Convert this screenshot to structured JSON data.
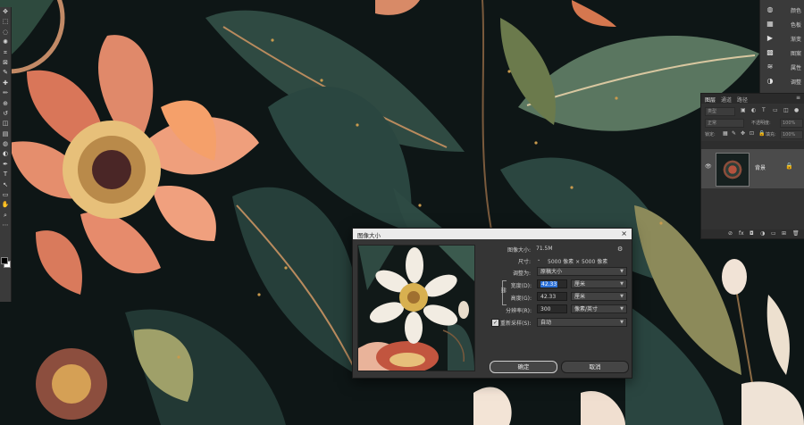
{
  "toolbar": {
    "icons": [
      "move-icon",
      "marquee-icon",
      "lasso-icon",
      "quick-select-icon",
      "crop-icon",
      "frame-icon",
      "eyedropper-icon",
      "healing-icon",
      "brush-icon",
      "stamp-icon",
      "history-brush-icon",
      "eraser-icon",
      "gradient-icon",
      "blur-icon",
      "dodge-icon",
      "pen-icon",
      "type-icon",
      "path-select-icon",
      "shape-icon",
      "hand-icon",
      "zoom-icon",
      "more-icon"
    ],
    "glyphs": [
      "✥",
      "⬚",
      "◌",
      "✺",
      "⌗",
      "⊠",
      "✎",
      "✚",
      "✏",
      "⊕",
      "↺",
      "◫",
      "▤",
      "◍",
      "◐",
      "✒",
      "T",
      "↖",
      "▭",
      "✋",
      "⌕",
      "⋯"
    ]
  },
  "dock": {
    "items": [
      {
        "icon": "brush-settings-icon",
        "glyph": "◍",
        "label": "颜色"
      },
      {
        "icon": "swatches-icon",
        "glyph": "▦",
        "label": "色板"
      },
      {
        "icon": "gradient-panel-icon",
        "glyph": "▶",
        "label": "渐变"
      },
      {
        "icon": "pattern-icon",
        "glyph": "▩",
        "label": "图案"
      },
      {
        "icon": "properties-icon",
        "glyph": "≋",
        "label": "属性"
      },
      {
        "icon": "adjust-icon",
        "glyph": "◑",
        "label": "调整"
      }
    ]
  },
  "layers": {
    "tabs": [
      "图层",
      "通道",
      "路径"
    ],
    "kind_placeholder": "类型",
    "mode": "正常",
    "opacity_label": "不透明度:",
    "opacity_value": "100%",
    "lock_label": "锁定:",
    "fill_label": "填充:",
    "fill_value": "100%",
    "layer_name": "背景",
    "footer_icons": [
      "link-icon",
      "fx-icon",
      "mask-icon",
      "adjustment-icon",
      "group-icon",
      "new-layer-icon",
      "trash-icon"
    ],
    "footer_glyphs": [
      "⊘",
      "fx",
      "◘",
      "◑",
      "▭",
      "⊞",
      "🗑"
    ]
  },
  "dialog": {
    "title": "图像大小",
    "close": "×",
    "image_size_label": "图像大小:",
    "image_size_value": "71.5M",
    "dimensions_label": "尺寸:",
    "dimensions_value": "5000 像素 × 5000 像素",
    "fit_label": "调整为:",
    "fit_value": "原稿大小",
    "width_label": "宽度(D):",
    "width_value": "42.33",
    "width_unit": "厘米",
    "height_label": "高度(G):",
    "height_value": "42.33",
    "height_unit": "厘米",
    "resolution_label": "分辨率(R):",
    "resolution_value": "300",
    "resolution_unit": "像素/英寸",
    "resample_label": "重新采样(S):",
    "resample_value": "自动",
    "ok": "确定",
    "cancel": "取消"
  }
}
